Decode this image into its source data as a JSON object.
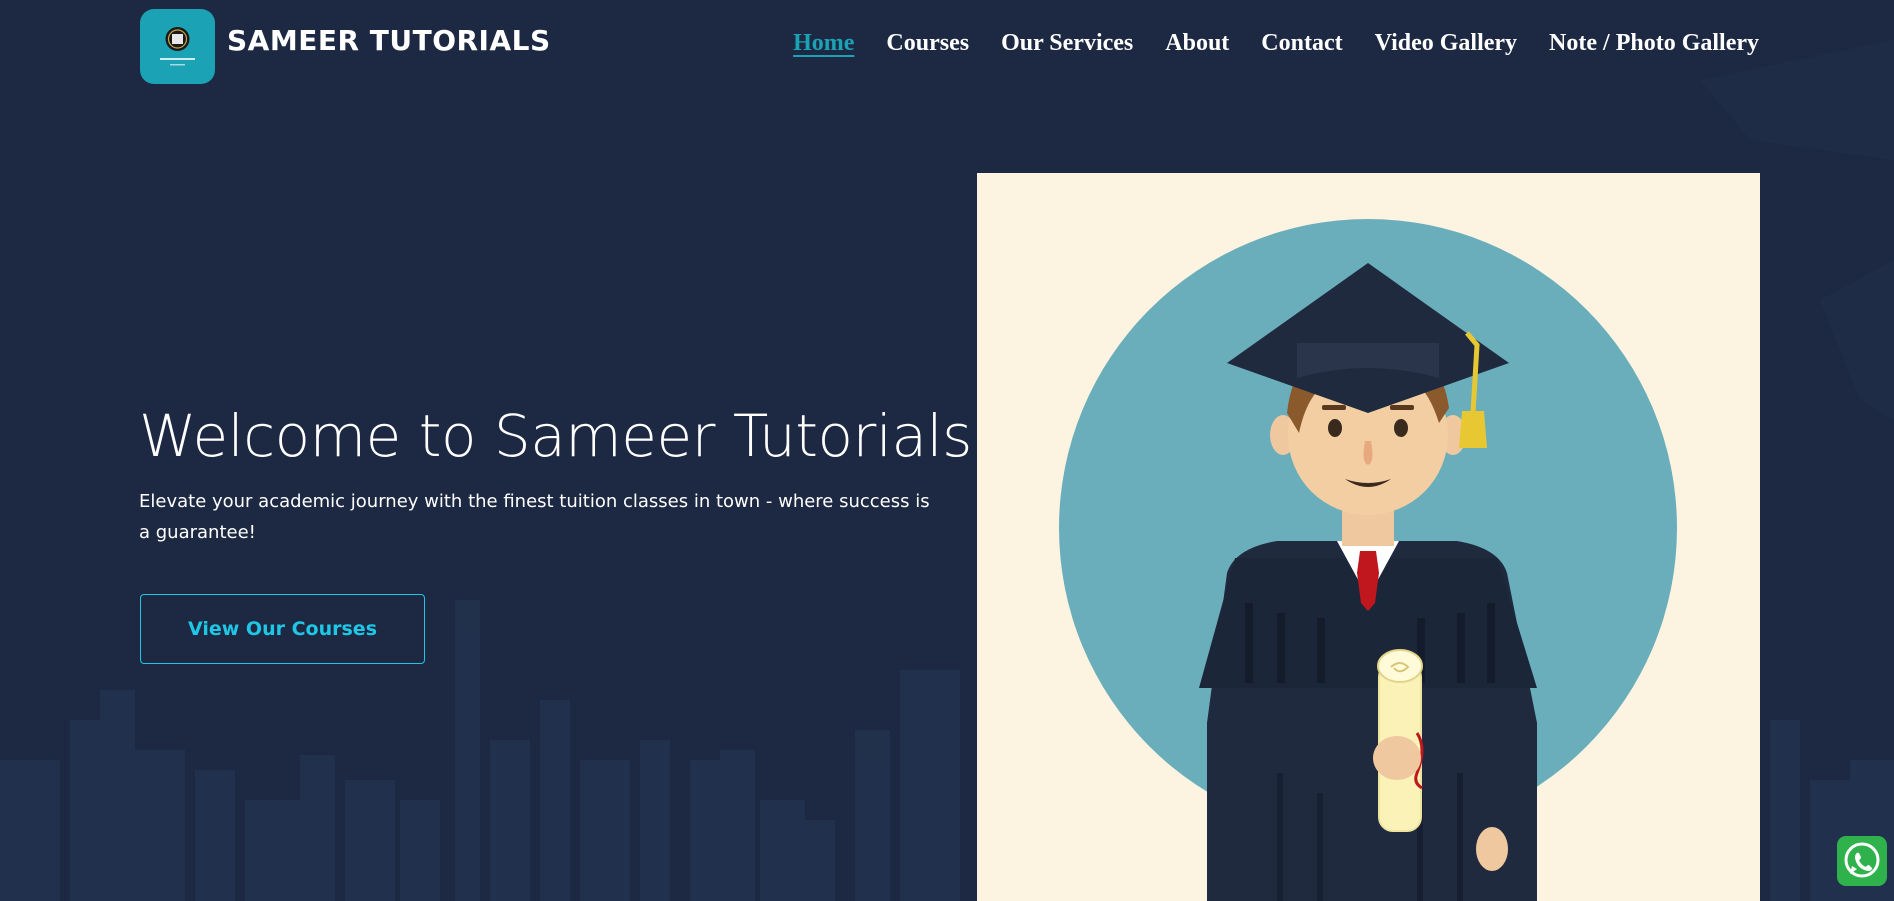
{
  "header": {
    "brand": "SAMEER TUTORIALS",
    "logo_icon": "sameer-tutorials-logo",
    "nav": [
      {
        "label": "Home",
        "active": true
      },
      {
        "label": "Courses",
        "active": false
      },
      {
        "label": "Our Services",
        "active": false
      },
      {
        "label": "About",
        "active": false
      },
      {
        "label": "Contact",
        "active": false
      },
      {
        "label": "Video Gallery",
        "active": false
      },
      {
        "label": "Note / Photo Gallery",
        "active": false
      }
    ]
  },
  "hero": {
    "title": "Welcome to Sameer Tutorials!",
    "subtitle": "Elevate your academic journey with the finest tuition classes in town - where success is a guarantee!",
    "cta_label": "View Our Courses",
    "illustration": "graduate-student-illustration"
  },
  "floating": {
    "icon": "whatsapp-icon"
  },
  "colors": {
    "background": "#1d2942",
    "accent": "#1ba3b5",
    "button_accent": "#1fc7e6",
    "illustration_bg": "#fdf3e1",
    "circle": "#6aaebb",
    "whatsapp": "#2fb24c"
  }
}
